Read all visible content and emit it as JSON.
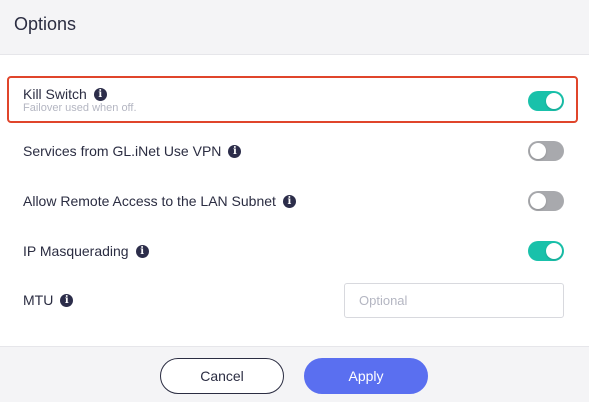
{
  "dialog": {
    "title": "Options"
  },
  "options": [
    {
      "label": "Kill Switch",
      "sublabel": "Failover used when off.",
      "enabled": true,
      "highlighted": true
    },
    {
      "label": "Services from GL.iNet Use VPN",
      "enabled": false
    },
    {
      "label": "Allow Remote Access to the LAN Subnet",
      "enabled": false
    },
    {
      "label": "IP Masquerading",
      "enabled": true
    }
  ],
  "mtu": {
    "label": "MTU",
    "value": "",
    "placeholder": "Optional"
  },
  "footer": {
    "cancel_label": "Cancel",
    "apply_label": "Apply"
  },
  "info_glyph": "i",
  "colors": {
    "toggle_on": "#19c1aa",
    "toggle_off": "#a8a9ad",
    "primary": "#5a6ff0",
    "highlight_border": "#e0452b"
  }
}
